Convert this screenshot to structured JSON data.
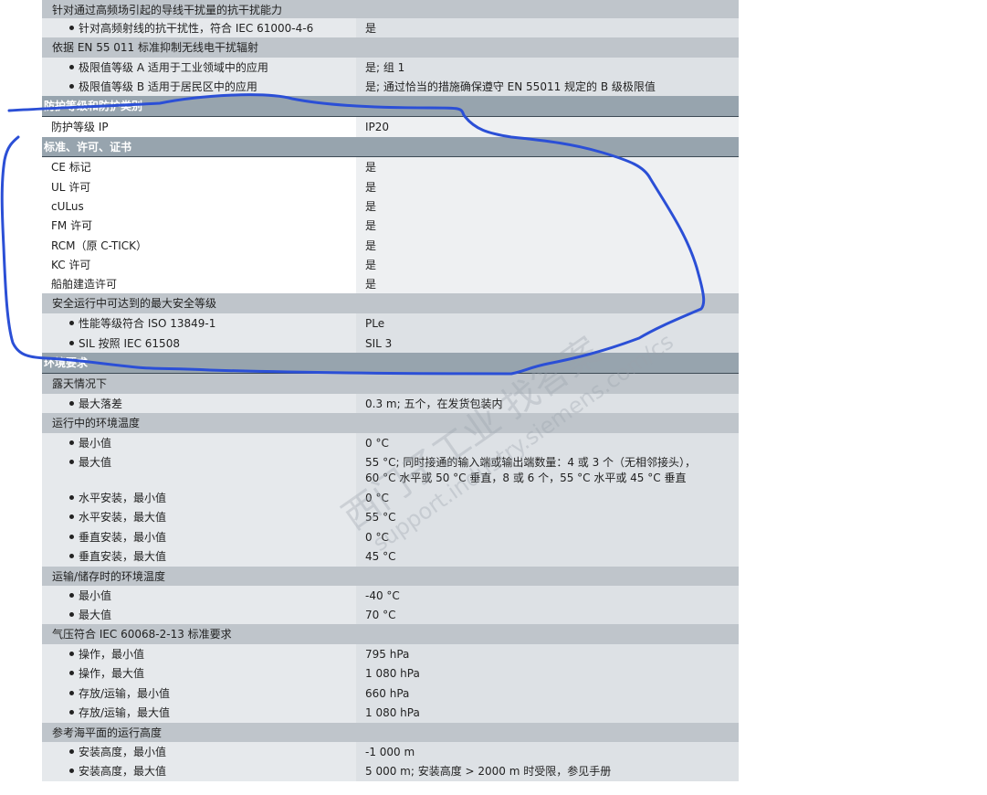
{
  "rows": [
    {
      "type": "group",
      "label": "针对通过高频场引起的导线干扰量的抗干扰能力",
      "h": 20
    },
    {
      "type": "item",
      "sub": true,
      "label": "针对高频射线的抗干扰性，符合 IEC 61000-4-6",
      "value": "是",
      "h": 21
    },
    {
      "type": "group",
      "label": "依据 EN 55 011 标准抑制无线电干扰辐射",
      "h": 22
    },
    {
      "type": "item",
      "sub": true,
      "label": "极限值等级 A 适用于工业领域中的应用",
      "value": "是; 组 1",
      "h": 21
    },
    {
      "type": "item",
      "sub": true,
      "label": "极限值等级 B 适用于居民区中的应用",
      "value": "是; 通过恰当的措施确保遵守 EN 55011 规定的 B 级极限值",
      "h": 21
    },
    {
      "type": "section",
      "label": "防护等级和防护类别",
      "h": 23
    },
    {
      "type": "plain",
      "label": "防护等级 IP",
      "value": "IP20",
      "h": 22
    },
    {
      "type": "section",
      "label": "标准、许可、证书",
      "h": 22
    },
    {
      "type": "plain",
      "label": "CE 标记",
      "value": "是",
      "h": 22
    },
    {
      "type": "plain",
      "label": "UL 许可",
      "value": "是",
      "h": 21
    },
    {
      "type": "plain",
      "label": "cULus",
      "value": "是",
      "h": 21
    },
    {
      "type": "plain",
      "label": "FM 许可",
      "value": "是",
      "h": 22
    },
    {
      "type": "plain",
      "label": "RCM（原 C-TICK）",
      "value": "是",
      "h": 21
    },
    {
      "type": "plain",
      "label": "KC 许可",
      "value": "是",
      "h": 21
    },
    {
      "type": "plain",
      "label": "船舶建造许可",
      "value": "是",
      "h": 21
    },
    {
      "type": "group",
      "label": "安全运行中可达到的最大安全等级",
      "h": 22
    },
    {
      "type": "item",
      "sub": true,
      "label": "性能等级符合 ISO 13849-1",
      "value": "PLe",
      "h": 22
    },
    {
      "type": "item",
      "sub": true,
      "label": "SIL 按照 IEC 61508",
      "value": "SIL 3",
      "h": 21
    },
    {
      "type": "section",
      "label": "环境要求",
      "h": 23
    },
    {
      "type": "group",
      "label": "露天情况下",
      "h": 22
    },
    {
      "type": "item",
      "sub": true,
      "label": "最大落差",
      "value": "0.3 m; 五个，在发货包装内",
      "h": 21
    },
    {
      "type": "group",
      "label": "运行中的环境温度",
      "h": 22
    },
    {
      "type": "item",
      "sub": true,
      "label": "最小值",
      "value": "0 °C",
      "h": 21
    },
    {
      "type": "item",
      "sub": true,
      "label": "最大值",
      "value": "55 °C; 同时接通的输入端或输出端数量：4 或 3 个（无相邻接头），",
      "value2": "60 °C 水平或 50 °C 垂直，8 或 6 个，55 °C 水平或 45 °C 垂直",
      "h": 39
    },
    {
      "type": "item",
      "sub": true,
      "label": "水平安装，最小值",
      "value": "0 °C",
      "h": 21
    },
    {
      "type": "item",
      "sub": true,
      "label": "水平安装，最大值",
      "value": "55 °C",
      "h": 22
    },
    {
      "type": "item",
      "sub": true,
      "label": "垂直安装，最小值",
      "value": "0 °C",
      "h": 21
    },
    {
      "type": "item",
      "sub": true,
      "label": "垂直安装，最大值",
      "value": "45 °C",
      "h": 22
    },
    {
      "type": "group",
      "label": "运输/储存时的环境温度",
      "h": 21
    },
    {
      "type": "item",
      "sub": true,
      "label": "最小值",
      "value": "-40 °C",
      "h": 21
    },
    {
      "type": "item",
      "sub": true,
      "label": "最大值",
      "value": "70 °C",
      "h": 21
    },
    {
      "type": "group",
      "label": "气压符合 IEC 60068-2-13 标准要求",
      "h": 22
    },
    {
      "type": "item",
      "sub": true,
      "label": "操作，最小值",
      "value": "795 hPa",
      "h": 21
    },
    {
      "type": "item",
      "sub": true,
      "label": "操作，最大值",
      "value": "1 080 hPa",
      "h": 22
    },
    {
      "type": "item",
      "sub": true,
      "label": "存放/运输，最小值",
      "value": "660 hPa",
      "h": 21
    },
    {
      "type": "item",
      "sub": true,
      "label": "存放/运输，最大值",
      "value": "1 080 hPa",
      "h": 22
    },
    {
      "type": "group",
      "label": "参考海平面的运行高度",
      "h": 21
    },
    {
      "type": "item",
      "sub": true,
      "label": "安装高度，最小值",
      "value": "-1 000 m",
      "h": 21
    },
    {
      "type": "item",
      "sub": true,
      "label": "安装高度，最大值",
      "value": "5 000 m; 安装高度 > 2000 m 时受限，参见手册",
      "h": 22
    }
  ],
  "watermark": {
    "text1": "西门子工业  找答案",
    "text2": "support.industry.siemens.com/cs"
  },
  "colors": {
    "annotation_stroke": "#2b4fd6"
  }
}
